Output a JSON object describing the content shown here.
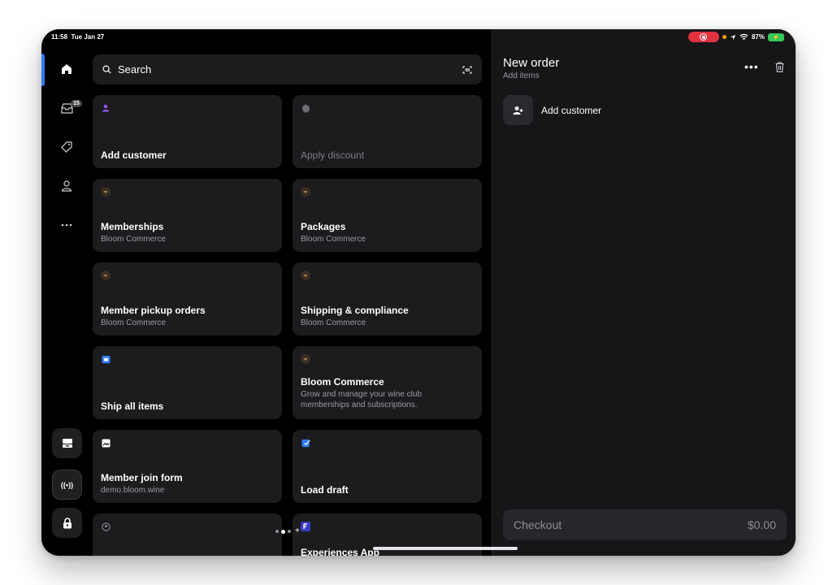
{
  "status_bar": {
    "time": "11:58",
    "date": "Tue Jan 27",
    "battery": "87%"
  },
  "sidebar": {
    "inbox_badge": "15"
  },
  "search": {
    "label": "Search"
  },
  "tiles": [
    {
      "title": "Add customer",
      "subtitle": ""
    },
    {
      "title": "Apply discount",
      "subtitle": ""
    },
    {
      "title": "Memberships",
      "subtitle": "Bloom Commerce"
    },
    {
      "title": "Packages",
      "subtitle": "Bloom Commerce"
    },
    {
      "title": "Member pickup orders",
      "subtitle": "Bloom Commerce"
    },
    {
      "title": "Shipping & compliance",
      "subtitle": "Bloom Commerce"
    },
    {
      "title": "Ship all items",
      "subtitle": ""
    },
    {
      "title": "Bloom Commerce",
      "subtitle": "Grow and manage your wine club memberships and subscriptions."
    },
    {
      "title": "Member join form",
      "subtitle": "demo.bloom.wine"
    },
    {
      "title": "Load draft",
      "subtitle": ""
    },
    {
      "title": "",
      "subtitle": ""
    },
    {
      "title": "Experiences App",
      "subtitle": ""
    }
  ],
  "order": {
    "title": "New order",
    "subtitle": "Add items",
    "add_customer": "Add customer",
    "checkout_label": "Checkout",
    "checkout_total": "$0.00"
  },
  "colors": {
    "accent_blue": "#2f7bf6",
    "purple": "#8e5cf7",
    "bloom_brown": "#5a4530",
    "recording_red": "#e0323f"
  }
}
